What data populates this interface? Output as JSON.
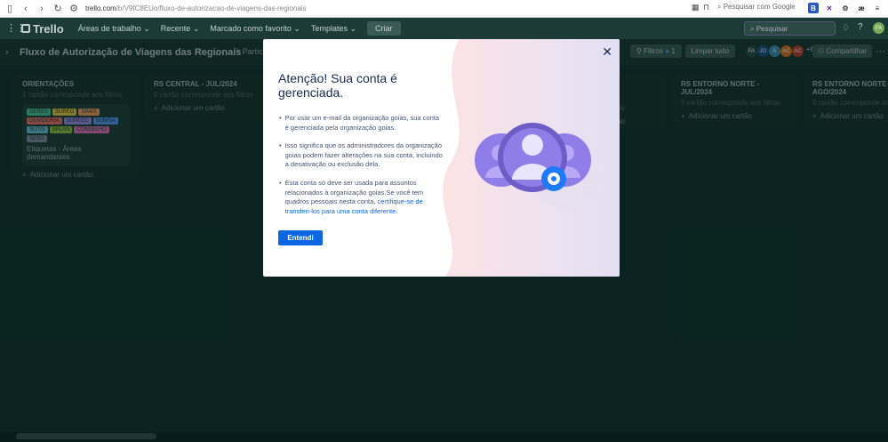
{
  "browser": {
    "url_host": "trello.com",
    "url_path": "/b/V9fC8EUo/fluxo-de-autorizacao-de-viagens-das-regionais",
    "search_placeholder": "Pesquisar com Google"
  },
  "app": {
    "logo": "Trello",
    "menu": [
      "Áreas de trabalho",
      "Recente",
      "Marcado como favorito",
      "Templates"
    ],
    "create_label": "Criar",
    "search_placeholder": "Pesquisar"
  },
  "board": {
    "title": "Fluxo de Autorização de Viagens das Regionais",
    "filters_label": "Filtros",
    "filters_count": "1",
    "clear_label": "Limpar tudo",
    "members_extra": "+63",
    "share_label": "Compartilhar"
  },
  "lists": [
    {
      "title": "ORIENTAÇÕES",
      "subtitle": "1 cartão corresponde aos filtros",
      "card_labels": [
        {
          "text": "GERES",
          "color": "#4bce97"
        },
        {
          "text": "SUREG",
          "color": "#f5cd47"
        },
        {
          "text": "SPAIS",
          "color": "#fea362"
        },
        {
          "text": "OUVIDORIA",
          "color": "#f87168"
        },
        {
          "text": "SUPECC",
          "color": "#9f8fef"
        },
        {
          "text": "SUNISA",
          "color": "#579dff"
        },
        {
          "text": "SUTIS",
          "color": "#6cc3e0"
        },
        {
          "text": "SPLAN",
          "color": "#94c748"
        },
        {
          "text": "CONSELHO",
          "color": "#e774bb"
        },
        {
          "text": "SESG",
          "color": "#8590a2"
        }
      ],
      "card_title": "Etiquetas - Áreas demandantes",
      "add_label": "Adicionar um cartão"
    },
    {
      "title": "RS CENTRAL - JUL/2024",
      "subtitle": "0 cartão corresponde aos filtros",
      "add_label": "Adicionar um cartão"
    },
    {
      "title": "RS ENTORNO NORTE - JUL/2024",
      "subtitle": "0 cartão corresponde aos filtros",
      "add_label": "Adicionar um cartão"
    },
    {
      "title": "RS ENTORNO NORTE - AGO/2024",
      "subtitle": "0 cartão corresponde aos filtros",
      "add_label": "Adicionar um cartão"
    }
  ],
  "partial_list": {
    "subtitle": "aos filtros",
    "add_label": "cartão"
  },
  "modal": {
    "title": "Atenção! Sua conta é gerenciada.",
    "items": [
      {
        "text": "Por usar um e-mail da organização goias, sua conta é gerenciada pela organização goias."
      },
      {
        "text": "Isso significa que os administradores da organização goias podem fazer alterações na sua conta, incluindo a desativação ou exclusão dela."
      },
      {
        "text": "Esta conta só deve ser usada para assuntos relacionados à organização goias.Se você tem quadros pessoais nesta conta, ",
        "link": "certifique-se de transferi-los para uma conta diferente."
      }
    ],
    "ok_label": "Entendi"
  }
}
